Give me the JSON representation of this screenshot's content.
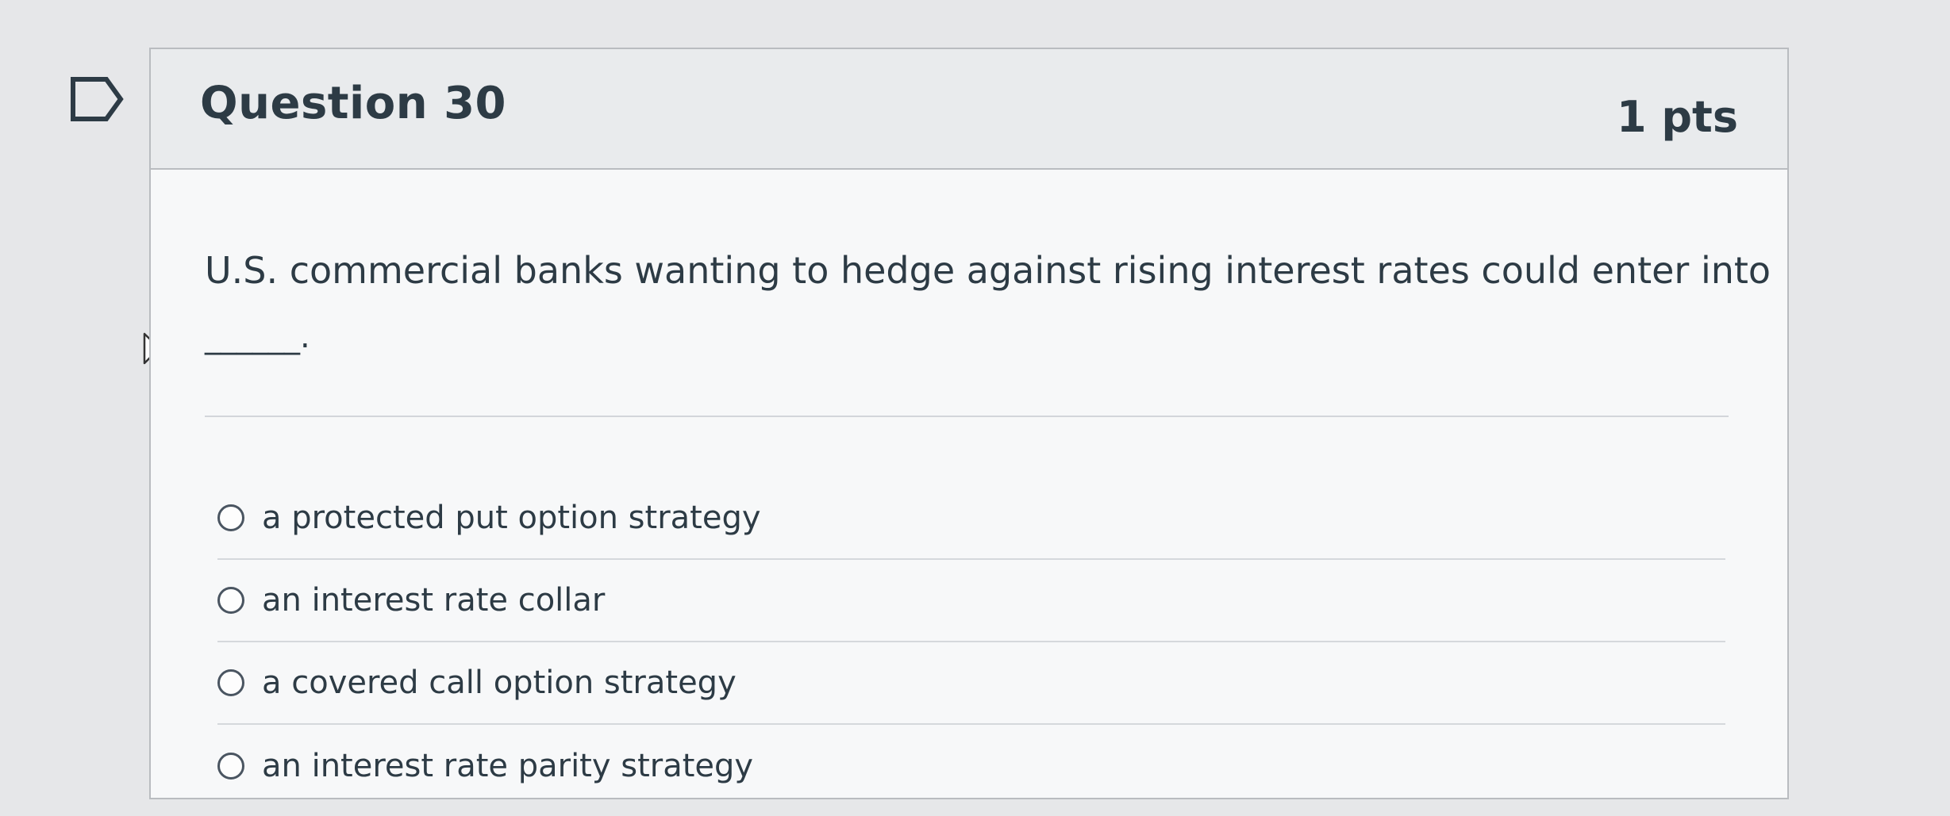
{
  "question": {
    "title": "Question 30",
    "points": "1 pts",
    "text": "U.S. commercial banks wanting to hedge against rising interest rates could enter into",
    "blank": "______."
  },
  "answers": [
    {
      "label": "a protected put option strategy"
    },
    {
      "label": "an interest rate collar"
    },
    {
      "label": "a covered call option strategy"
    },
    {
      "label": "an interest rate parity strategy"
    }
  ],
  "icons": {
    "flag": "flag-outline-icon",
    "cursor": "mouse-pointer-icon"
  }
}
